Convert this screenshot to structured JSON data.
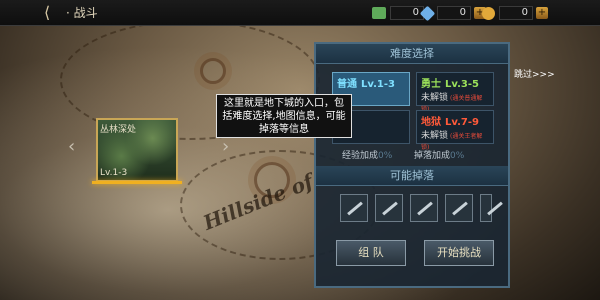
{
  "topbar": {
    "title": "战斗",
    "resources": [
      {
        "icon": "ticket-icon",
        "value": "0",
        "color": "#5faa5a"
      },
      {
        "icon": "diamond-icon",
        "value": "0",
        "color": "#6fb0e8"
      },
      {
        "icon": "gold-coin-icon",
        "value": "0",
        "color": "#e2a93a"
      }
    ]
  },
  "map": {
    "label": "Hillside of"
  },
  "dungeon_card": {
    "name": "丛林深处",
    "level": "Lv.1-3"
  },
  "tutorial": {
    "text": "这里就是地下城的入口，包括难度选择,地图信息，可能掉落等信息",
    "skip_label": "跳过>>>"
  },
  "panel": {
    "difficulty_title": "难度选择",
    "difficulties": [
      {
        "name": "普通",
        "level": "Lv.1-3",
        "name_color": "#7fe0ff",
        "level_color": "#7fe0ff",
        "status": "",
        "note": ""
      },
      {
        "name": "勇士",
        "level": "Lv.3-5",
        "name_color": "#9be05a",
        "level_color": "#9be05a",
        "status": "未解锁",
        "note": "(通关普通解锁)"
      },
      {
        "name": "",
        "level": "",
        "name_color": "#ffd24a",
        "level_color": "#ffd24a",
        "status": "",
        "note": ""
      },
      {
        "name": "地狱",
        "level": "Lv.7-9",
        "name_color": "#ff5a3a",
        "level_color": "#ff5a3a",
        "status": "未解锁",
        "note": "(通关王者解锁)"
      }
    ],
    "exp_bonus_label": "经验加成",
    "exp_bonus_value": "0%",
    "drop_bonus_label": "掉落加成",
    "drop_bonus_value": "0%",
    "drops_title": "可能掉落",
    "drops": [
      "blade-icon",
      "sword-icon",
      "greatsword-icon",
      "dagger-icon",
      "spear-icon"
    ],
    "team_button": "组 队",
    "start_button": "开始挑战"
  }
}
